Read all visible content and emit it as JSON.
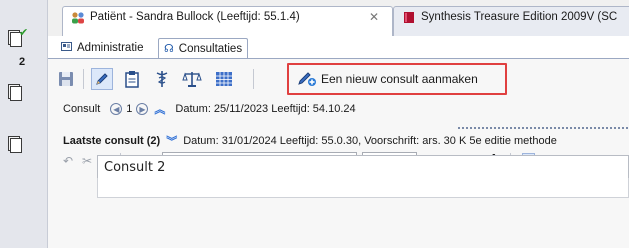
{
  "rail": {
    "count": "2"
  },
  "tabs": {
    "patient": "Patiënt - Sandra Bullock (Leeftijd: 55.1.4)",
    "synthesis": "Synthesis Treasure Edition 2009V (SC"
  },
  "subtabs": {
    "admin": "Administratie",
    "consult": "Consultaties"
  },
  "toolbar": {
    "new_consult": "Een nieuw consult aanmaken"
  },
  "consult": {
    "label": "Consult",
    "index": "1",
    "date": "Datum: 25/11/2023 Leeftijd: 54.10.24"
  },
  "laatste": {
    "label": "Laatste consult (2)",
    "info": "Datum: 31/01/2024 Leeftijd: 55.0.30,  Voorschrift: ars. 30 K 5e editie methode"
  },
  "format": {
    "font": "Verdana",
    "size": "11"
  },
  "editor": {
    "text": "Consult 2"
  },
  "colors": {
    "highlight": "#e04040",
    "accent": "#2e6fd6"
  }
}
